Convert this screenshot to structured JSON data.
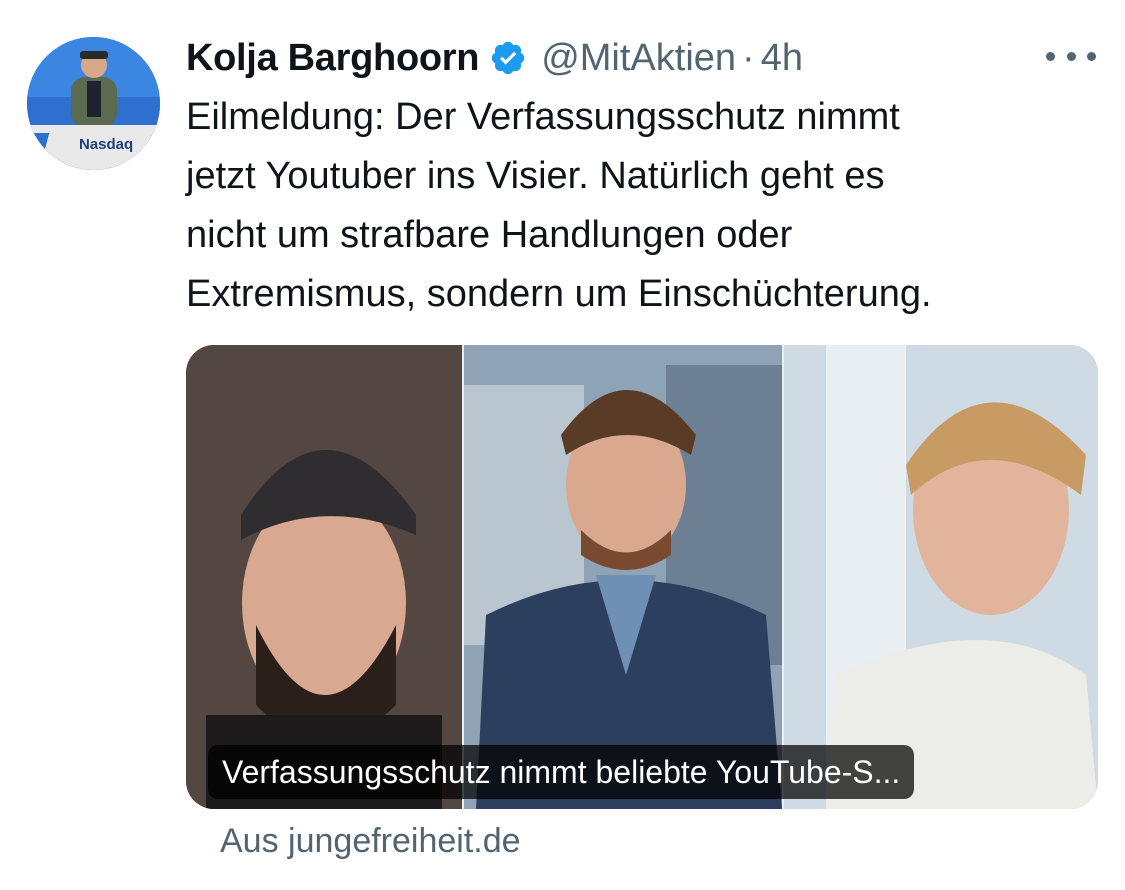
{
  "tweet": {
    "author_name": "Kolja Barghoorn",
    "handle": "@MitAktien",
    "separator": "·",
    "time": "4h",
    "text": "Eilmeldung: Der Verfassungsschutz nimmt\njetzt  Youtuber ins Visier. Natürlich geht es\nnicht um strafbare Handlungen oder\nExtremismus, sondern um Einschüchterung.",
    "avatar_sign_text": "Nasdaq"
  },
  "link_card": {
    "title": "Verfassungsschutz nimmt beliebte YouTube-S...",
    "source": "Aus jungefreiheit.de"
  },
  "icons": {
    "verified": "verified-badge-icon",
    "more": "more-options-icon"
  },
  "colors": {
    "text_primary": "#0f1419",
    "text_secondary": "#536471",
    "verified_blue": "#1d9bf0"
  }
}
